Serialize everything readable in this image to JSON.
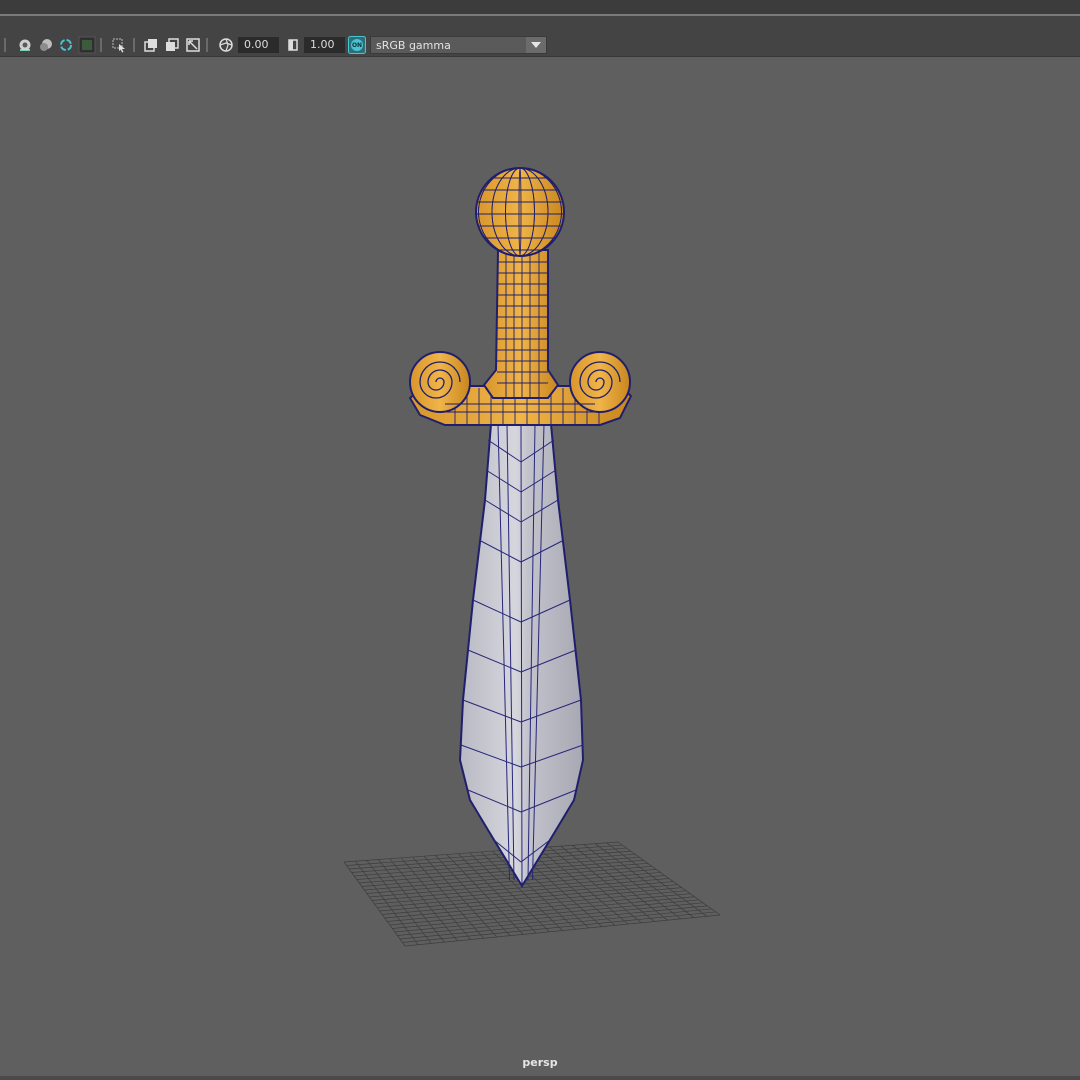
{
  "toolbar": {
    "exposure_value": "0.00",
    "gamma_value": "1.00",
    "color_management_badge": "ON",
    "color_space": "sRGB gamma"
  },
  "viewport": {
    "camera": "persp"
  },
  "colors": {
    "viewport_bg": "#5f5f5f",
    "toolbar_bg": "#444444",
    "hilt_gold": "#e9a93c",
    "blade_gray": "#c9c9d2",
    "wire_blue": "#1f1f6e",
    "accent_teal": "#2aa6b3"
  },
  "icons": [
    "xray-joint-icon",
    "xray-icon",
    "wireframe-on-shaded-icon",
    "isolate-select-icon",
    "select-camera-icon",
    "hud-icon",
    "resolution-gate-icon",
    "film-gate-icon",
    "field-chart-icon",
    "exposure-icon",
    "gamma-icon",
    "color-management-icon"
  ]
}
